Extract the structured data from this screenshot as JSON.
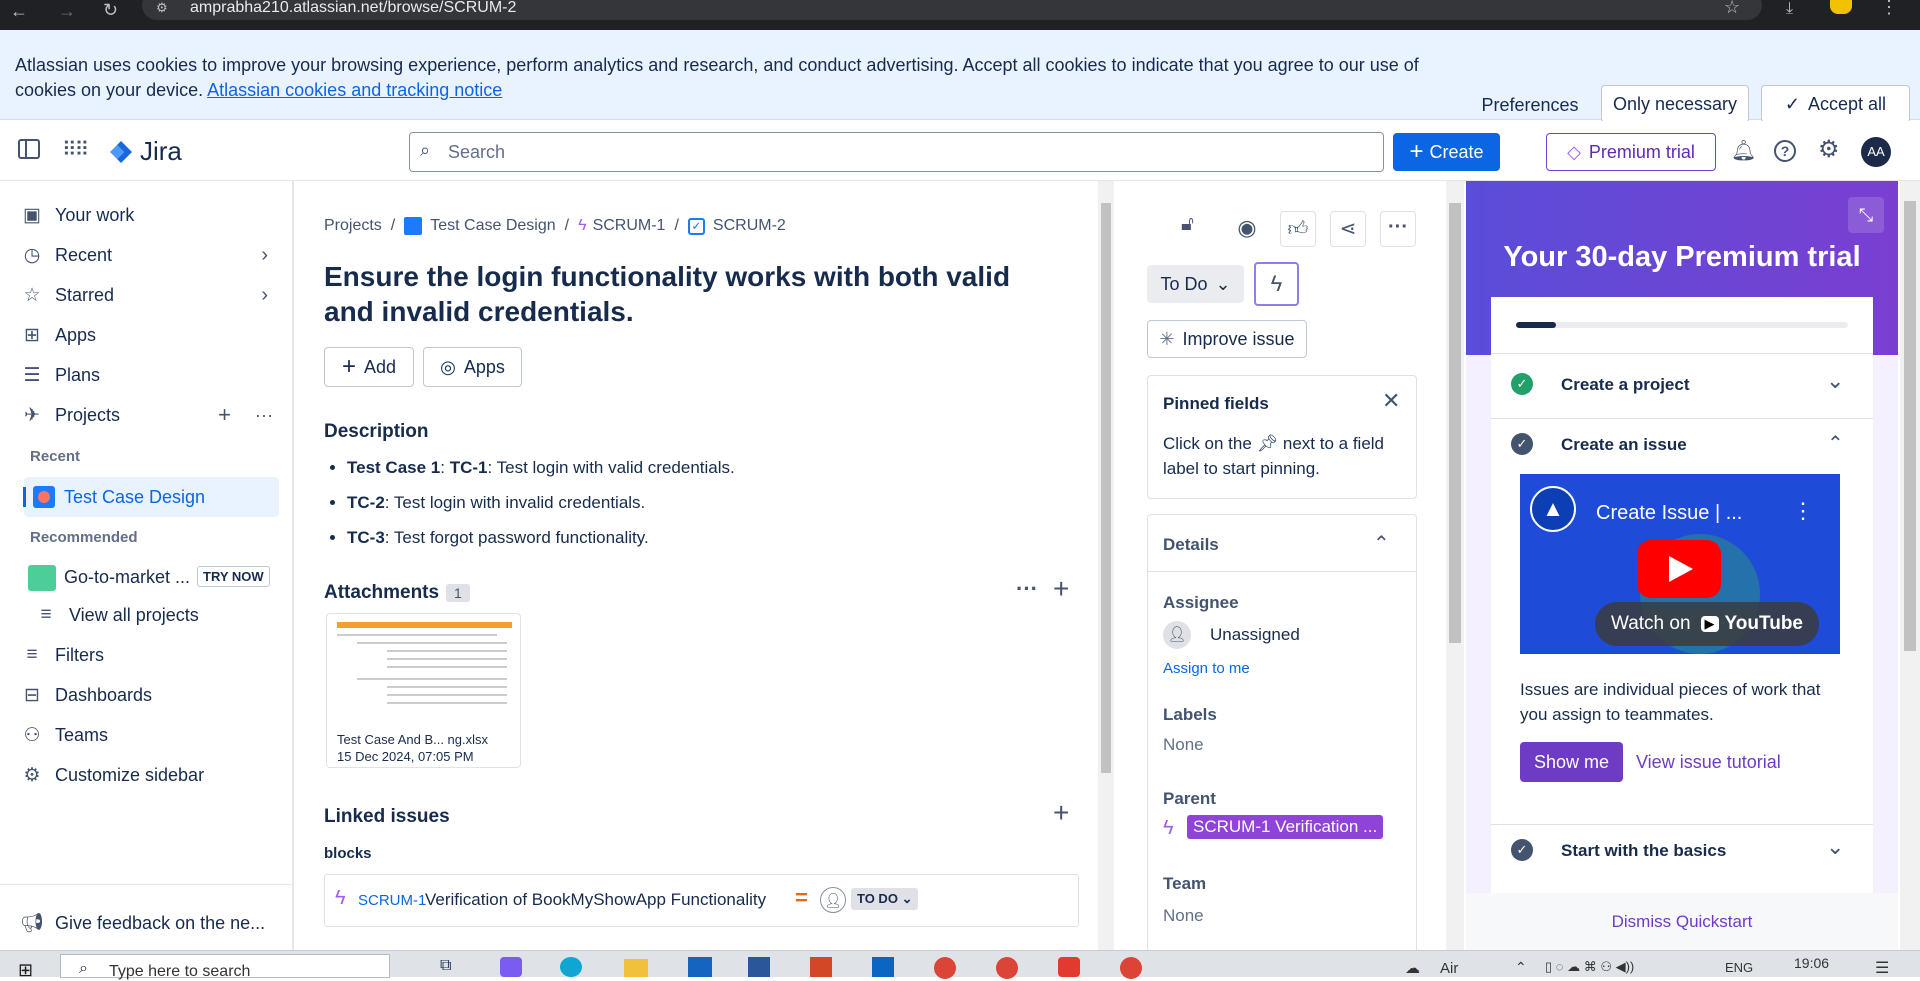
{
  "browser": {
    "url": "amprabha210.atlassian.net/browse/SCRUM-2"
  },
  "cookie_banner": {
    "message": "Atlassian uses cookies to improve your browsing experience, perform analytics and research, and conduct advertising. Accept all cookies to indicate that you agree to our use of cookies on your device.",
    "link": "Atlassian cookies and tracking notice",
    "preferences": "Preferences",
    "only_necessary": "Only necessary",
    "accept_all": "Accept all"
  },
  "topnav": {
    "product": "Jira",
    "search_placeholder": "Search",
    "create": "Create",
    "premium_trial": "Premium trial",
    "avatar": "AA"
  },
  "sidebar": {
    "your_work": "Your work",
    "recent": "Recent",
    "starred": "Starred",
    "apps": "Apps",
    "plans": "Plans",
    "projects": "Projects",
    "recent_heading": "Recent",
    "recent_project": "Test Case Design",
    "recommended_heading": "Recommended",
    "recommended_project": "Go-to-market ...",
    "try_now": "TRY NOW",
    "view_all_projects": "View all projects",
    "filters": "Filters",
    "dashboards": "Dashboards",
    "teams": "Teams",
    "customize": "Customize sidebar",
    "feedback": "Give feedback on the ne..."
  },
  "breadcrumb": {
    "projects": "Projects",
    "sep": "/",
    "project": "Test Case Design",
    "parent": "SCRUM-1",
    "issue": "SCRUM-2"
  },
  "issue": {
    "title": "Ensure the login functionality works with both valid and invalid credentials.",
    "add": "Add",
    "apps": "Apps",
    "description_heading": "Description",
    "desc_items": [
      {
        "bold": "Test Case 1",
        "sep": ": ",
        "bold2": "TC-1",
        "text": ": Test login with valid credentials."
      },
      {
        "bold": "TC-2",
        "text": ": Test login with invalid credentials."
      },
      {
        "bold": "TC-3",
        "text": ": Test forgot password functionality."
      }
    ],
    "attachments_heading": "Attachments",
    "attachments_count": "1",
    "attachment": {
      "name": "Test Case And B... ng.xlsx",
      "date": "15 Dec 2024, 07:05 PM"
    },
    "linked_heading": "Linked issues",
    "link_type": "blocks",
    "linked": {
      "key": "SCRUM-1",
      "summary": "Verification of BookMyShowApp Functionality",
      "status": "TO DO"
    }
  },
  "details": {
    "status": "To Do",
    "improve": "Improve issue",
    "pinned_title": "Pinned fields",
    "pinned_text_a": "Click on the",
    "pinned_text_b": "next to a field label to start pinning.",
    "details_title": "Details",
    "assignee_label": "Assignee",
    "assignee_value": "Unassigned",
    "assign_to_me": "Assign to me",
    "labels_label": "Labels",
    "labels_value": "None",
    "parent_label": "Parent",
    "parent_value": "SCRUM-1 Verification ...",
    "team_label": "Team",
    "team_value": "None"
  },
  "premium": {
    "title": "Your 30-day Premium trial",
    "progress": 0.12,
    "step1": "Create a project",
    "step2": "Create an issue",
    "video_title": "Create Issue | ...",
    "watch_on": "Watch on",
    "youtube": "YouTube",
    "desc": "Issues are individual pieces of work that you assign to teammates.",
    "show_me": "Show me",
    "tutorial": "View issue tutorial",
    "step3": "Start with the basics",
    "dismiss": "Dismiss Quickstart"
  },
  "taskbar": {
    "search": "Type here to search",
    "time": "19:06",
    "lang": "ENG",
    "weather": "Air"
  },
  "colors": {
    "accent": "#0c66e4",
    "purple": "#6e3cc4",
    "trial_grad_a": "#5a4dd8",
    "trial_grad_b": "#7a3fd1"
  }
}
